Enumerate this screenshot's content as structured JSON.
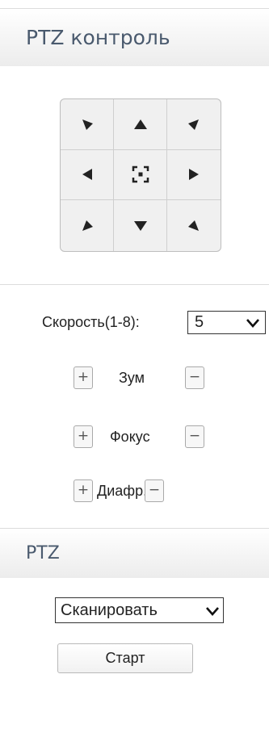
{
  "ptz_control": {
    "title": "PTZ контроль",
    "direction_pad": [
      {
        "name": "up-left",
        "icon": "arrow-up-left-icon"
      },
      {
        "name": "up",
        "icon": "arrow-up-icon"
      },
      {
        "name": "up-right",
        "icon": "arrow-up-right-icon"
      },
      {
        "name": "left",
        "icon": "arrow-left-icon"
      },
      {
        "name": "home",
        "icon": "center-focus-icon"
      },
      {
        "name": "right",
        "icon": "arrow-right-icon"
      },
      {
        "name": "down-left",
        "icon": "arrow-down-left-icon"
      },
      {
        "name": "down",
        "icon": "arrow-down-icon"
      },
      {
        "name": "down-right",
        "icon": "arrow-down-right-icon"
      }
    ],
    "speed": {
      "label": "Скорость(1-8):",
      "value": "5"
    },
    "zoom": {
      "label": "Зум",
      "plus": "+",
      "minus": "−"
    },
    "focus": {
      "label": "Фокус",
      "plus": "+",
      "minus": "−"
    },
    "iris": {
      "label": "Диафр.",
      "plus": "+",
      "minus": "−"
    }
  },
  "ptz": {
    "title": "PTZ",
    "mode": {
      "value": "Сканировать"
    },
    "start_label": "Старт"
  },
  "colors": {
    "header_text": "#4a5a6e",
    "header_bg_top": "#ffffff",
    "header_bg_bottom": "#ececec",
    "pad_bg": "#f0f0f0",
    "arrow": "#222222"
  }
}
